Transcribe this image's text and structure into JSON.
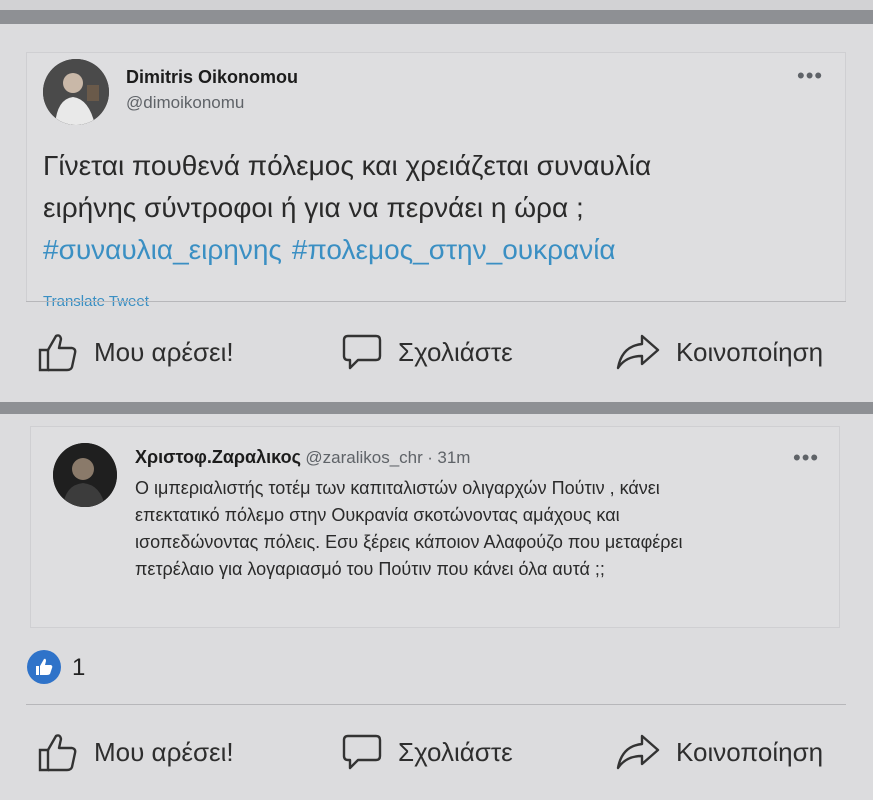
{
  "post1": {
    "tweet": {
      "author_name": "Dimitris Oikonomou",
      "author_handle": "@dimoikonomu",
      "more_label": "•••",
      "text_line1": "Γίνεται πουθενά πόλεμος και χρειάζεται συναυλία",
      "text_line2": "ειρήνης σύντροφοι ή για να περνάει η ώρα ;",
      "hashtags": [
        "#συναυλια_ειρηνης",
        "#πολεμος_στην_ουκρανία"
      ],
      "translate_label": "Translate Tweet"
    },
    "actions": {
      "like": "Μου αρέσει!",
      "comment": "Σχολιάστε",
      "share": "Κοινοποίηση"
    }
  },
  "post2": {
    "tweet": {
      "author_name": "Χριστοφ.Ζαραλικος",
      "author_handle": "@zaralikos_chr",
      "separator": "·",
      "time": "31m",
      "more_label": "•••",
      "lines": [
        "Ο ιμπεριαλιστής τοτέμ των καπιταλιστών ολιγαρχών Πούτιν , κάνει",
        "επεκτατικό πόλεμο στην Ουκρανία σκοτώνοντας αμάχους και",
        "ισοπεδώνοντας πόλεις. Εσυ ξέρεις κάποιον Αλαφούζο που μεταφέρει",
        "πετρέλαιο για λογαριασμό του Πούτιν που κάνει όλα αυτά ;;"
      ]
    },
    "reactions": {
      "like_count": "1"
    },
    "actions": {
      "like": "Μου αρέσει!",
      "comment": "Σχολιάστε",
      "share": "Κοινοποίηση"
    }
  },
  "colors": {
    "hashtag": "#3a8fc3",
    "like_badge": "#2f73c9",
    "separator_band": "#8e9094"
  }
}
